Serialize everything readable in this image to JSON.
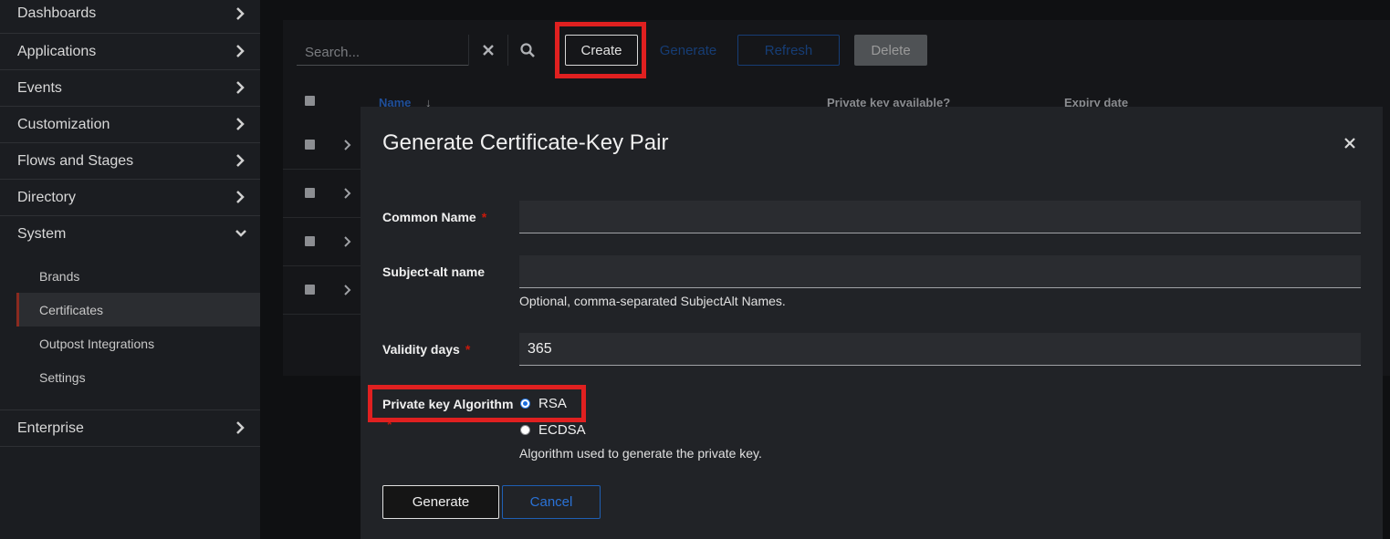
{
  "sidebar": {
    "items": [
      {
        "label": "Dashboards"
      },
      {
        "label": "Applications"
      },
      {
        "label": "Events"
      },
      {
        "label": "Customization"
      },
      {
        "label": "Flows and Stages"
      },
      {
        "label": "Directory"
      },
      {
        "label": "System",
        "expanded": true
      }
    ],
    "system_sub": [
      "Brands",
      "Certificates",
      "Outpost Integrations",
      "Settings"
    ],
    "active_sub": "Certificates",
    "enterprise": "Enterprise"
  },
  "toolbar": {
    "search_placeholder": "Search...",
    "create": "Create",
    "generate": "Generate",
    "refresh": "Refresh",
    "delete": "Delete"
  },
  "table": {
    "col_name": "Name",
    "col_private_key": "Private key available?",
    "col_expiry": "Expiry date"
  },
  "modal": {
    "title": "Generate Certificate-Key Pair",
    "common_name": {
      "label": "Common Name",
      "required": "*",
      "value": ""
    },
    "subject_alt": {
      "label": "Subject-alt name",
      "value": "",
      "helper": "Optional, comma-separated SubjectAlt Names."
    },
    "validity": {
      "label": "Validity days",
      "required": "*",
      "value": "365"
    },
    "algorithm": {
      "label": "Private key Algorithm",
      "required": "*",
      "options": [
        "RSA",
        "ECDSA"
      ],
      "selected": "RSA",
      "helper": "Algorithm used to generate the private key."
    },
    "generate_button": "Generate",
    "cancel_button": "Cancel"
  },
  "colors": {
    "highlight": "#e02020",
    "accent": "#2b7de9",
    "required": "#c9190b"
  }
}
